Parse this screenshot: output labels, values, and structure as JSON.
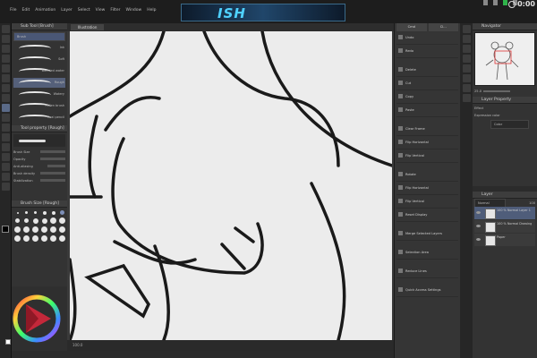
{
  "menu": [
    "File",
    "Edit",
    "Animation",
    "Layer",
    "Select",
    "View",
    "Filter",
    "Window",
    "Help"
  ],
  "banner": {
    "text": "ISH"
  },
  "status": {
    "timer": "0:00"
  },
  "subtool": {
    "title": "Sub Tool [Brush]",
    "group": "Brush",
    "brushes": [
      {
        "label": "Ink"
      },
      {
        "label": "Soft"
      },
      {
        "label": "Blended water"
      },
      {
        "label": "Rough"
      },
      {
        "label": "Watery"
      },
      {
        "label": "Pollen brush"
      },
      {
        "label": "Real pencil"
      }
    ]
  },
  "tool_property": {
    "title": "Tool property [Rough]",
    "rows": [
      "Brush Size",
      "Opacity",
      "Anti-aliasing",
      "Brush density",
      "Stabilization"
    ]
  },
  "brush_size": {
    "title": "Brush Size [Rough]"
  },
  "canvas": {
    "tab": "Illustration",
    "status": "100.0"
  },
  "commands": {
    "tabs": [
      "Cmd",
      "Cl..."
    ],
    "items": [
      "Undo",
      "Redo",
      "Delete",
      "Cut",
      "Copy",
      "Paste",
      "Clear Frame",
      "Flip Horizontal",
      "Flip Vertical",
      "Rotate",
      "Flip Horizontal",
      "Flip Vertical",
      "Reset Display",
      "Merge Selected Layers",
      "Selection Area",
      "Reduce Lines",
      "Quick Access Settings"
    ]
  },
  "navigator": {
    "title": "Navigator",
    "zoom": "25.0"
  },
  "layer_property": {
    "title": "Layer Property",
    "expression_color": "Expression color",
    "color": "Color",
    "effect": "Effect"
  },
  "layers": {
    "title": "Layer",
    "blend": "Normal",
    "opacity": "100",
    "items": [
      {
        "name": "100 % Normal Layer 1"
      },
      {
        "name": "100 % Normal Drawing"
      },
      {
        "name": "Paper"
      }
    ]
  }
}
